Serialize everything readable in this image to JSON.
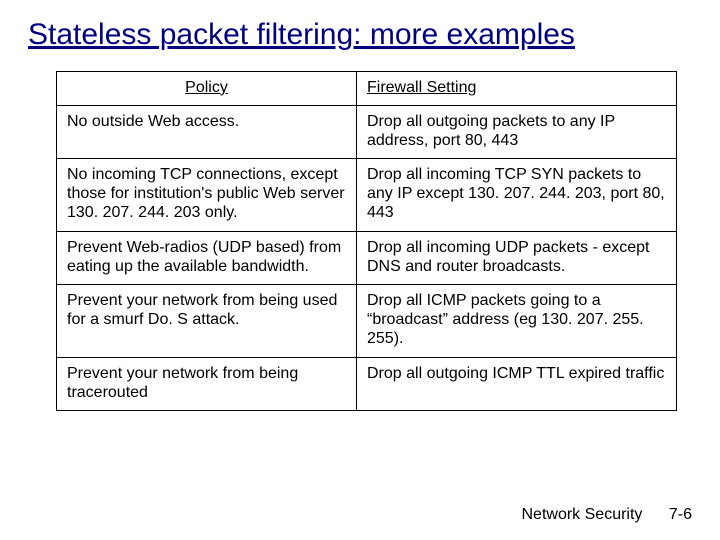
{
  "title": "Stateless packet filtering: more examples",
  "table": {
    "headers": {
      "policy": "Policy",
      "setting": "Firewall Setting"
    },
    "rows": [
      {
        "policy": "No outside Web access.",
        "setting": "Drop all outgoing packets to any IP address, port 80, 443"
      },
      {
        "policy": "No incoming TCP connections, except those for institution's public Web server 130. 207. 244. 203 only.",
        "setting": "Drop all incoming TCP SYN packets to any IP except 130. 207. 244. 203, port 80, 443"
      },
      {
        "policy": "Prevent Web-radios (UDP based) from eating up the available bandwidth.",
        "setting": "Drop all incoming UDP packets - except DNS and router broadcasts."
      },
      {
        "policy": "Prevent your network from being used for a smurf Do. S attack.",
        "setting": "Drop all ICMP packets going to a “broadcast” address (eg 130. 207. 255. 255)."
      },
      {
        "policy": "Prevent your network from being tracerouted",
        "setting": "Drop all outgoing ICMP TTL expired traffic"
      }
    ]
  },
  "footer": {
    "label": "Network Security",
    "page": "7-6"
  }
}
